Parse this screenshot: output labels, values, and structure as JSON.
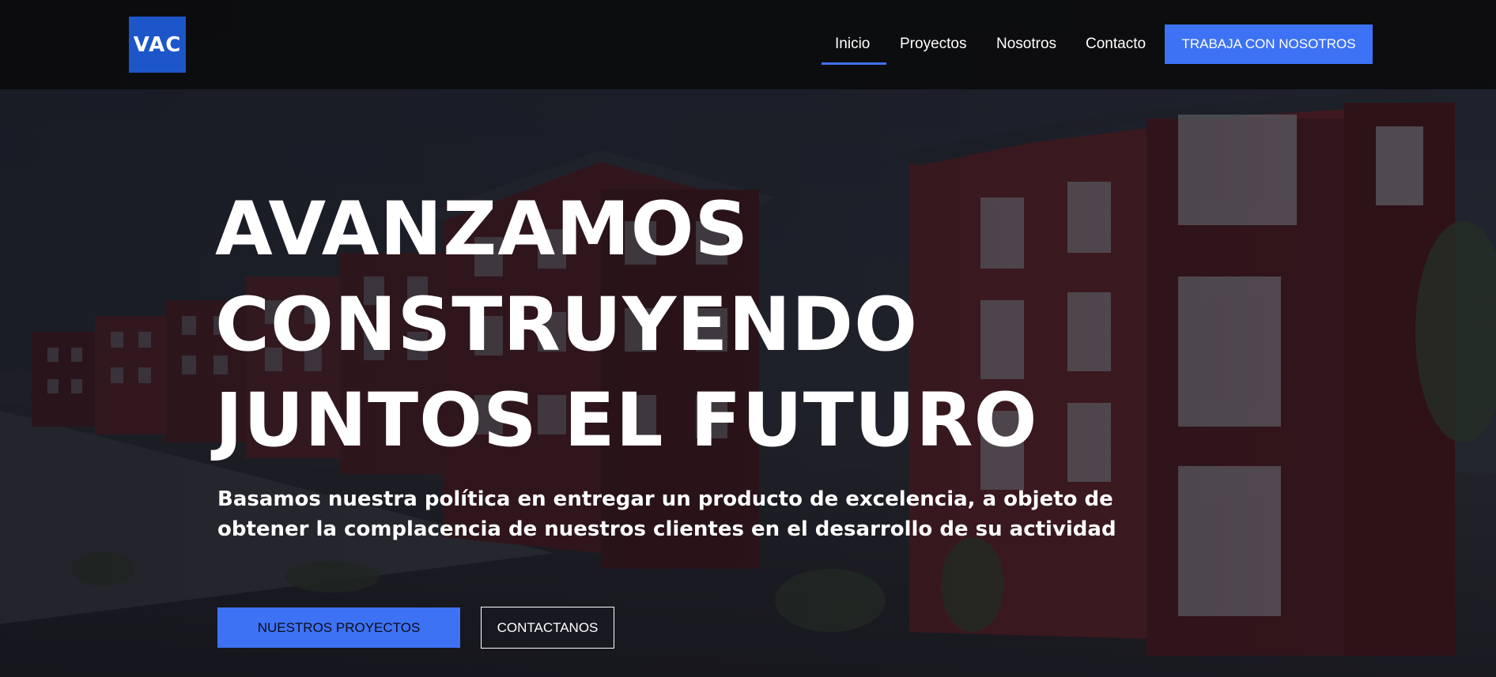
{
  "brand": {
    "logo_text": "VAC",
    "logo_color": "#1d56c9"
  },
  "nav": {
    "items": [
      {
        "label": "Inicio",
        "active": true
      },
      {
        "label": "Proyectos",
        "active": false
      },
      {
        "label": "Nosotros",
        "active": false
      },
      {
        "label": "Contacto",
        "active": false
      }
    ],
    "cta_label": "TRABAJA CON NOSOTROS",
    "accent_color": "#3d72f4"
  },
  "hero": {
    "title_lines": [
      "AVANZAMOS",
      "CONSTRUYENDO",
      "JUNTOS EL FUTURO"
    ],
    "subtitle_lines": [
      "Basamos nuestra política en entregar un producto de excelencia, a objeto de",
      "obtener la complacencia de nuestros clientes en el desarrollo de su actividad"
    ],
    "primary_button": "NUESTROS PROYECTOS",
    "secondary_button": "CONTACTANOS"
  }
}
